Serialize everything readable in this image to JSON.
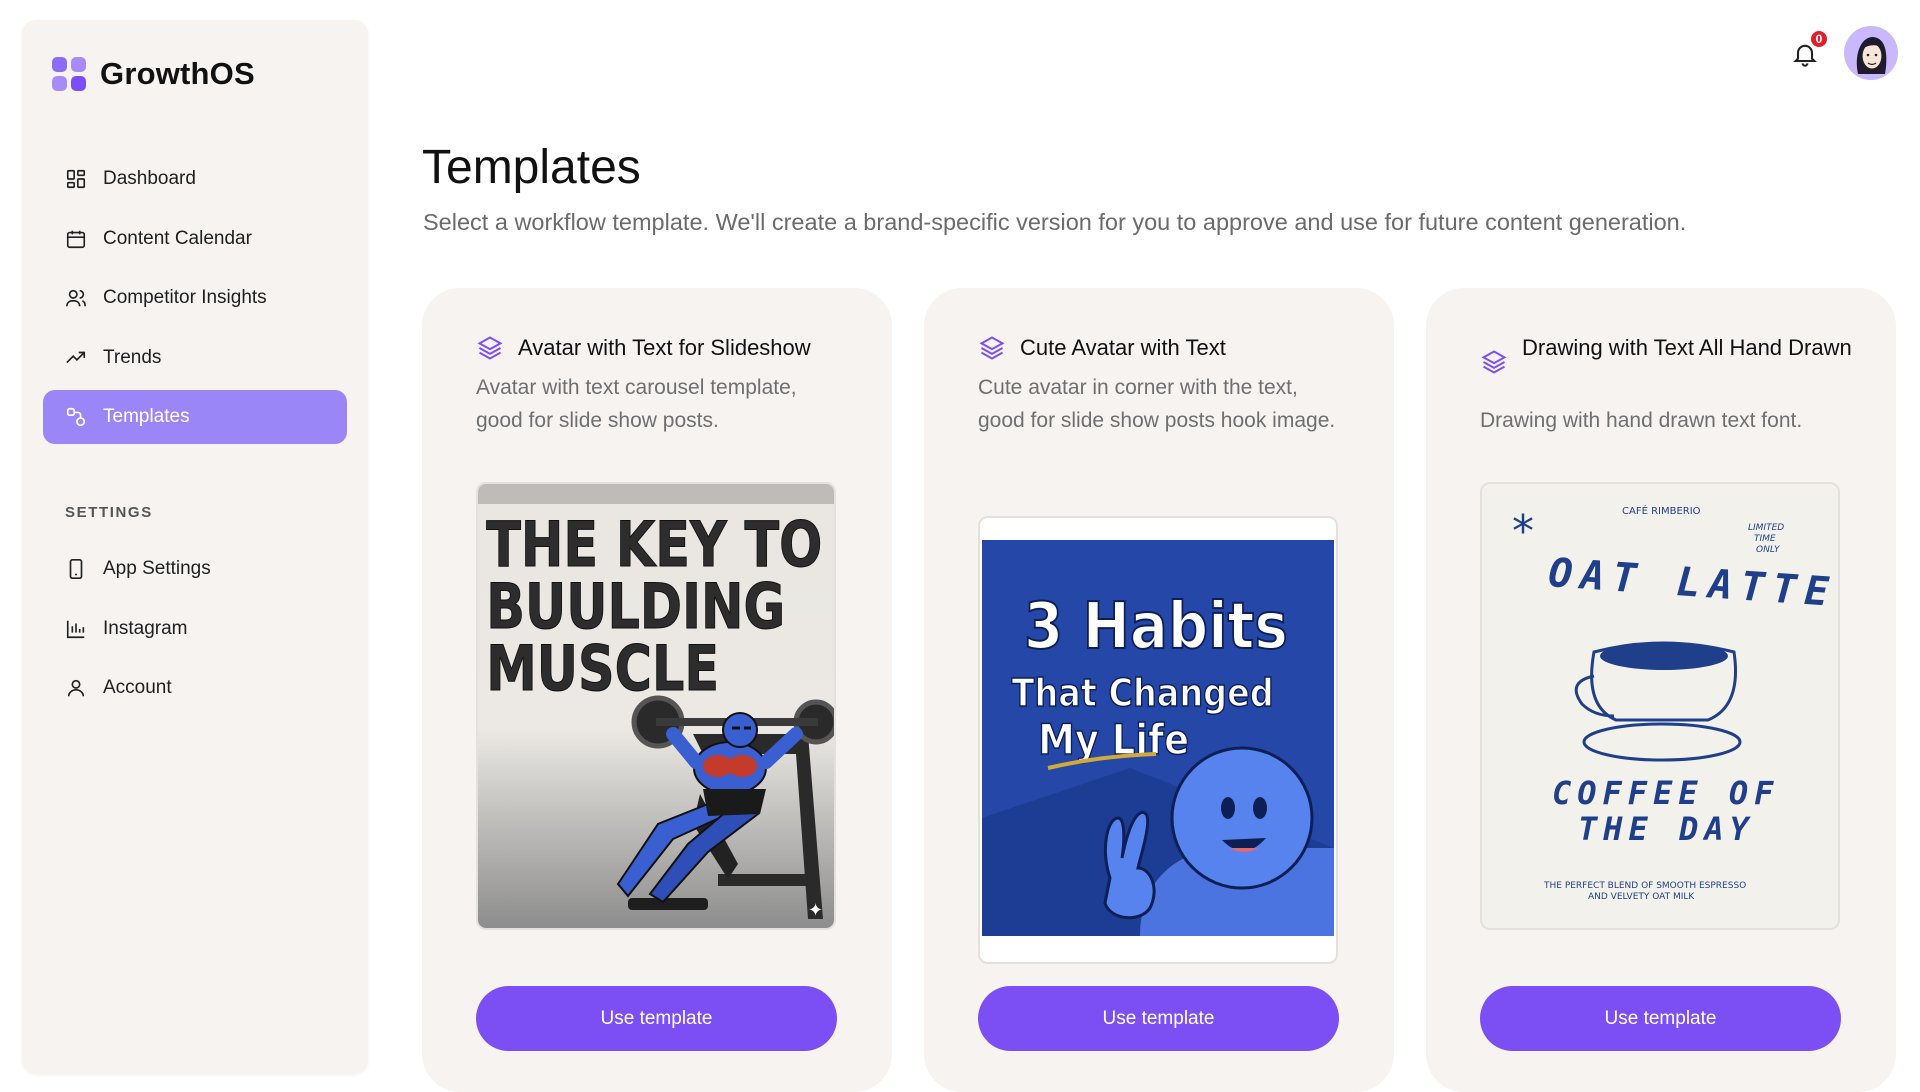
{
  "app": {
    "name": "GrowthOS"
  },
  "sidebar": {
    "items": [
      {
        "label": "Dashboard",
        "icon": "dashboard-icon"
      },
      {
        "label": "Content Calendar",
        "icon": "calendar-icon"
      },
      {
        "label": "Competitor Insights",
        "icon": "users-icon"
      },
      {
        "label": "Trends",
        "icon": "trend-icon"
      },
      {
        "label": "Templates",
        "icon": "templates-icon",
        "active": true
      }
    ],
    "settings_label": "SETTINGS",
    "settings_items": [
      {
        "label": "App Settings",
        "icon": "phone-icon"
      },
      {
        "label": "Instagram",
        "icon": "bar-chart-icon"
      },
      {
        "label": "Account",
        "icon": "user-icon"
      }
    ]
  },
  "header": {
    "notification_count": "0"
  },
  "main": {
    "title": "Templates",
    "subtitle": "Select a workflow template. We'll create a brand-specific version for you to approve and use for future content generation."
  },
  "cards": [
    {
      "title": "Avatar with Text for Slideshow",
      "description": "Avatar with text carousel template, good for slide show posts.",
      "image_text": [
        "THE KEY TO",
        "BUULDING",
        "MUSCLE"
      ],
      "button": "Use template"
    },
    {
      "title": "Cute Avatar with Text",
      "description": "Cute avatar in corner with the text, good for slide show posts hook image.",
      "image_text": [
        "3 Habits",
        "That Changed",
        "My Life"
      ],
      "button": "Use template"
    },
    {
      "title": "Drawing with Text All Hand Drawn",
      "description": "Drawing with hand drawn text font.",
      "image_text": {
        "brand": "CAFÉ RIMBERIO",
        "tag": [
          "LIMITED",
          "TIME",
          "ONLY"
        ],
        "headline": "OAT LATTE",
        "sub": [
          "COFFEE OF",
          "THE DAY"
        ],
        "footer": [
          "THE PERFECT BLEND OF SMOOTH ESPRESSO",
          "AND VELVETY OAT MILK"
        ]
      },
      "button": "Use template"
    }
  ],
  "colors": {
    "accent": "#7c4ff5",
    "active_nav": "#9b86f8",
    "panel": "#f6f3f1",
    "badge": "#e11d2a"
  }
}
